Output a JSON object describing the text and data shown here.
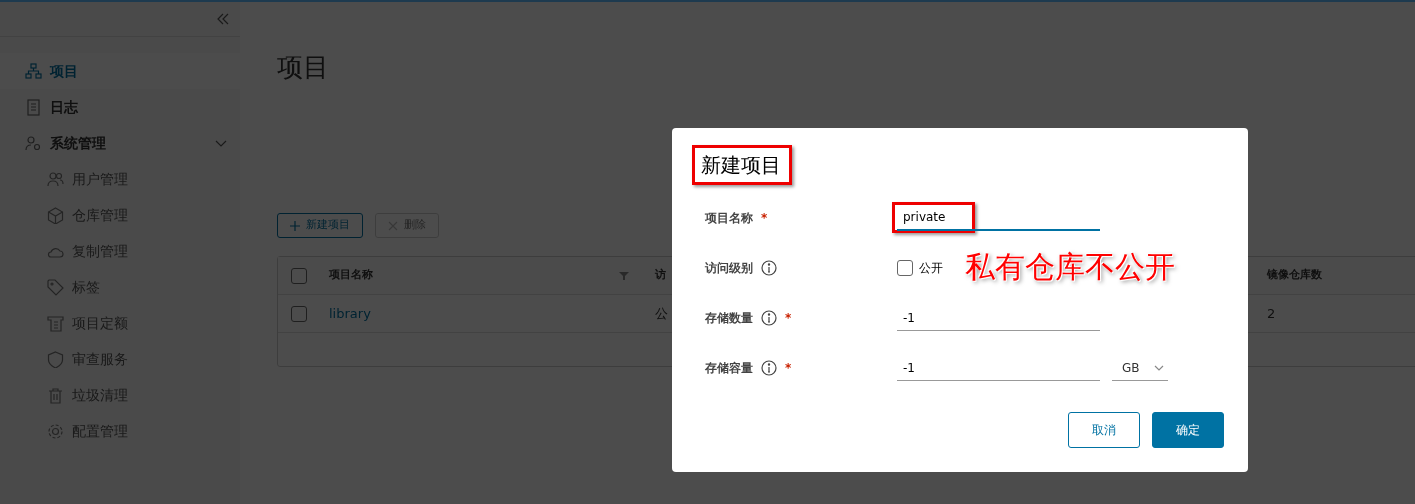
{
  "sidebar": {
    "items": [
      {
        "label": "项目",
        "selected": true
      },
      {
        "label": "日志",
        "selected": false
      },
      {
        "label": "系统管理",
        "selected": false,
        "expanded": true,
        "children": [
          {
            "label": "用户管理",
            "selected": false
          },
          {
            "label": "仓库管理",
            "selected": false
          },
          {
            "label": "复制管理",
            "selected": false
          },
          {
            "label": "标签",
            "selected": false
          },
          {
            "label": "项目定额",
            "selected": false
          },
          {
            "label": "审查服务",
            "selected": false
          },
          {
            "label": "垃圾清理",
            "selected": false
          },
          {
            "label": "配置管理",
            "selected": false
          }
        ]
      }
    ]
  },
  "page": {
    "title": "项目",
    "toolbar": [
      {
        "label": "新建项目",
        "disabled": false
      },
      {
        "label": "删除",
        "disabled": true
      }
    ],
    "table": {
      "header_checked": false,
      "columns": [
        "项目名称",
        "访",
        "镜像仓库数"
      ],
      "rows": [
        {
          "checked": false,
          "cells": [
            "library",
            "公",
            "2"
          ]
        }
      ]
    }
  },
  "dialog": {
    "title": "新建项目",
    "title_highlighted": true,
    "fields": [
      {
        "kind": "text",
        "label": "项目名称",
        "info": false,
        "required_mark": "*",
        "value": "private",
        "focused": true,
        "highlighted": true
      },
      {
        "kind": "checkbox",
        "label": "访问级别",
        "info": true,
        "option": "公开",
        "checked": false
      },
      {
        "kind": "text",
        "label": "存储数量",
        "info": true,
        "required_mark": "*",
        "value": "-1",
        "focused": false,
        "highlighted": false
      },
      {
        "kind": "unit",
        "label": "存储容量",
        "info": true,
        "required_mark": "*",
        "value": "-1",
        "unit": "GB",
        "focused": false,
        "highlighted": false
      }
    ],
    "buttons": [
      {
        "label": "取消",
        "kind": "secondary"
      },
      {
        "label": "确定",
        "kind": "primary"
      }
    ],
    "note": "私有仓库不公开"
  }
}
